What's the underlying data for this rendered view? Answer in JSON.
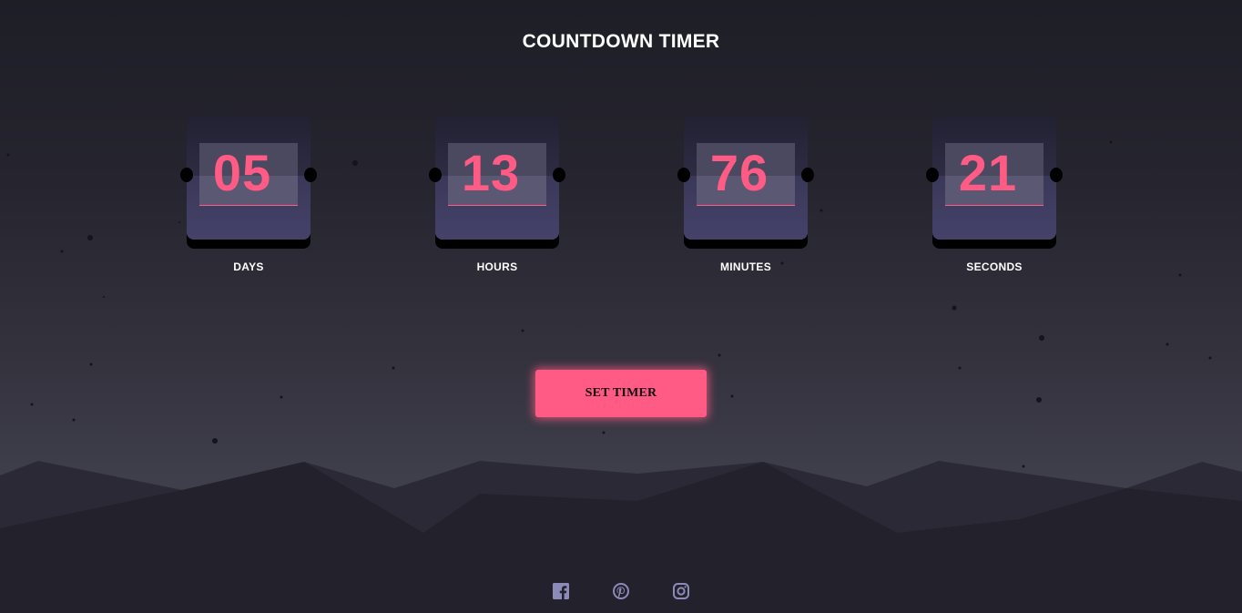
{
  "header": {
    "title": "COUNTDOWN TIMER"
  },
  "timer": {
    "units": [
      {
        "value": "05",
        "label": "DAYS"
      },
      {
        "value": "13",
        "label": "HOURS"
      },
      {
        "value": "76",
        "label": "MINUTES"
      },
      {
        "value": "21",
        "label": "SECONDS"
      }
    ]
  },
  "actions": {
    "set_timer_label": "SET TIMER"
  },
  "socials": [
    "facebook-icon",
    "pinterest-icon",
    "instagram-icon"
  ],
  "colors": {
    "accent": "#ff5b84",
    "card": "#3f3d63",
    "icon": "#8c8ab8"
  }
}
